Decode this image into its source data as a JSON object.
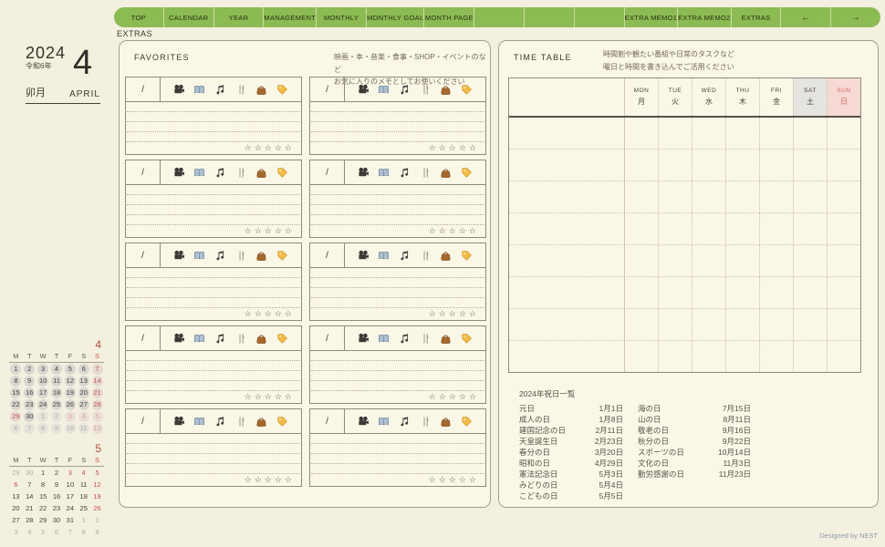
{
  "page_label": "EXTRAS",
  "nav": {
    "tabs": [
      "TOP",
      "CALENDAR",
      "YEAR",
      "MANAGEMENT",
      "MONTHLY",
      "MONTHLY GOAL",
      "MONTH PAGE",
      "",
      "",
      "",
      "EXTRA MEMO1",
      "EXTRA MEMO2",
      "EXTRAS",
      "←",
      "→"
    ]
  },
  "sidebar": {
    "year": "2024",
    "era": "令和6年",
    "month_number": "4",
    "month_jp": "卯月",
    "month_en": "APRIL",
    "mini_calendars": [
      {
        "month_label": "4",
        "day_headers": [
          "M",
          "T",
          "W",
          "T",
          "F",
          "S",
          "S"
        ],
        "has_circles": true,
        "weeks": [
          [
            [
              "1",
              "n"
            ],
            [
              "2",
              "n"
            ],
            [
              "3",
              "n"
            ],
            [
              "4",
              "n"
            ],
            [
              "5",
              "n"
            ],
            [
              "6",
              "n"
            ],
            [
              "7",
              "r"
            ]
          ],
          [
            [
              "8",
              "n"
            ],
            [
              "9",
              "n"
            ],
            [
              "10",
              "n"
            ],
            [
              "11",
              "n"
            ],
            [
              "12",
              "n"
            ],
            [
              "13",
              "n"
            ],
            [
              "14",
              "r"
            ]
          ],
          [
            [
              "15",
              "n"
            ],
            [
              "16",
              "n"
            ],
            [
              "17",
              "n"
            ],
            [
              "18",
              "n"
            ],
            [
              "19",
              "n"
            ],
            [
              "20",
              "n"
            ],
            [
              "21",
              "r"
            ]
          ],
          [
            [
              "22",
              "n"
            ],
            [
              "23",
              "n"
            ],
            [
              "24",
              "n"
            ],
            [
              "25",
              "n"
            ],
            [
              "26",
              "n"
            ],
            [
              "27",
              "n"
            ],
            [
              "28",
              "r"
            ]
          ],
          [
            [
              "29",
              "r"
            ],
            [
              "30",
              "n"
            ],
            [
              "1",
              "o"
            ],
            [
              "2",
              "o"
            ],
            [
              "3",
              "or"
            ],
            [
              "4",
              "or"
            ],
            [
              "5",
              "or"
            ]
          ],
          [
            [
              "6",
              "o"
            ],
            [
              "7",
              "o"
            ],
            [
              "8",
              "o"
            ],
            [
              "9",
              "o"
            ],
            [
              "10",
              "o"
            ],
            [
              "11",
              "o"
            ],
            [
              "12",
              "or"
            ]
          ]
        ]
      },
      {
        "month_label": "5",
        "day_headers": [
          "M",
          "T",
          "W",
          "T",
          "F",
          "S",
          "S"
        ],
        "has_circles": false,
        "weeks": [
          [
            [
              "29",
              "o"
            ],
            [
              "30",
              "o"
            ],
            [
              "1",
              "n"
            ],
            [
              "2",
              "n"
            ],
            [
              "3",
              "r"
            ],
            [
              "4",
              "r"
            ],
            [
              "5",
              "r"
            ]
          ],
          [
            [
              "6",
              "r"
            ],
            [
              "7",
              "n"
            ],
            [
              "8",
              "n"
            ],
            [
              "9",
              "n"
            ],
            [
              "10",
              "n"
            ],
            [
              "11",
              "n"
            ],
            [
              "12",
              "r"
            ]
          ],
          [
            [
              "13",
              "n"
            ],
            [
              "14",
              "n"
            ],
            [
              "15",
              "n"
            ],
            [
              "16",
              "n"
            ],
            [
              "17",
              "n"
            ],
            [
              "18",
              "n"
            ],
            [
              "19",
              "r"
            ]
          ],
          [
            [
              "20",
              "n"
            ],
            [
              "21",
              "n"
            ],
            [
              "22",
              "n"
            ],
            [
              "23",
              "n"
            ],
            [
              "24",
              "n"
            ],
            [
              "25",
              "n"
            ],
            [
              "26",
              "r"
            ]
          ],
          [
            [
              "27",
              "n"
            ],
            [
              "28",
              "n"
            ],
            [
              "29",
              "n"
            ],
            [
              "30",
              "n"
            ],
            [
              "31",
              "n"
            ],
            [
              "1",
              "o"
            ],
            [
              "2",
              "o"
            ]
          ],
          [
            [
              "3",
              "o"
            ],
            [
              "4",
              "o"
            ],
            [
              "5",
              "o"
            ],
            [
              "6",
              "o"
            ],
            [
              "7",
              "o"
            ],
            [
              "8",
              "o"
            ],
            [
              "9",
              "o"
            ]
          ]
        ]
      }
    ]
  },
  "favorites": {
    "title": "FAVORITES",
    "note_line1": "映画・本・音楽・食事・SHOP・イベントのなど",
    "note_line2": "お気に入りのメモとしてお使いください",
    "card_count": 10,
    "slash": "/",
    "icons": [
      "movie-camera",
      "book",
      "music-notes",
      "fork-knife",
      "handbag",
      "tag"
    ],
    "memo_lines": 4,
    "stars": "☆☆☆☆☆"
  },
  "timetable": {
    "title": "TIME TABLE",
    "note_line1": "時間割や観たい番組や日常のタスクなど",
    "note_line2": "曜日と時間を書き込んでご活用ください",
    "columns": [
      {
        "en": "MON",
        "jp": "月",
        "variant": "weekday"
      },
      {
        "en": "TUE",
        "jp": "火",
        "variant": "weekday"
      },
      {
        "en": "WED",
        "jp": "水",
        "variant": "weekday"
      },
      {
        "en": "THU",
        "jp": "木",
        "variant": "weekday"
      },
      {
        "en": "FRI",
        "jp": "金",
        "variant": "weekday"
      },
      {
        "en": "SAT",
        "jp": "土",
        "variant": "saturday"
      },
      {
        "en": "SUN",
        "jp": "日",
        "variant": "sunday"
      }
    ],
    "body_rows": 8
  },
  "holidays": {
    "title": "2024年祝日一覧",
    "col1": [
      {
        "name": "元日",
        "date": "1月1日"
      },
      {
        "name": "成人の日",
        "date": "1月8日"
      },
      {
        "name": "建国記念の日",
        "date": "2月11日"
      },
      {
        "name": "天皇誕生日",
        "date": "2月23日"
      },
      {
        "name": "春分の日",
        "date": "3月20日"
      },
      {
        "name": "昭和の日",
        "date": "4月29日"
      },
      {
        "name": "憲法記念日",
        "date": "5月3日"
      },
      {
        "name": "みどりの日",
        "date": "5月4日"
      },
      {
        "name": "こどもの日",
        "date": "5月5日"
      }
    ],
    "col2": [
      {
        "name": "海の日",
        "date": "7月15日"
      },
      {
        "name": "山の日",
        "date": "8月11日"
      },
      {
        "name": "敬老の日",
        "date": "9月16日"
      },
      {
        "name": "秋分の日",
        "date": "9月22日"
      },
      {
        "name": "スポーツの日",
        "date": "10月14日"
      },
      {
        "name": "文化の日",
        "date": "11月3日"
      },
      {
        "name": "勤労感謝の日",
        "date": "11月23日"
      }
    ]
  },
  "footer": {
    "credit": "Designed by NEST"
  },
  "colors": {
    "nav_green": "#8dbb53",
    "accent_red": "#c4534a",
    "sat_header_bg": "#e5e4e0",
    "sun_header_bg": "#f7d9d5",
    "page_bg": "#f4f0e0",
    "panel_bg": "#fbf7e7"
  }
}
